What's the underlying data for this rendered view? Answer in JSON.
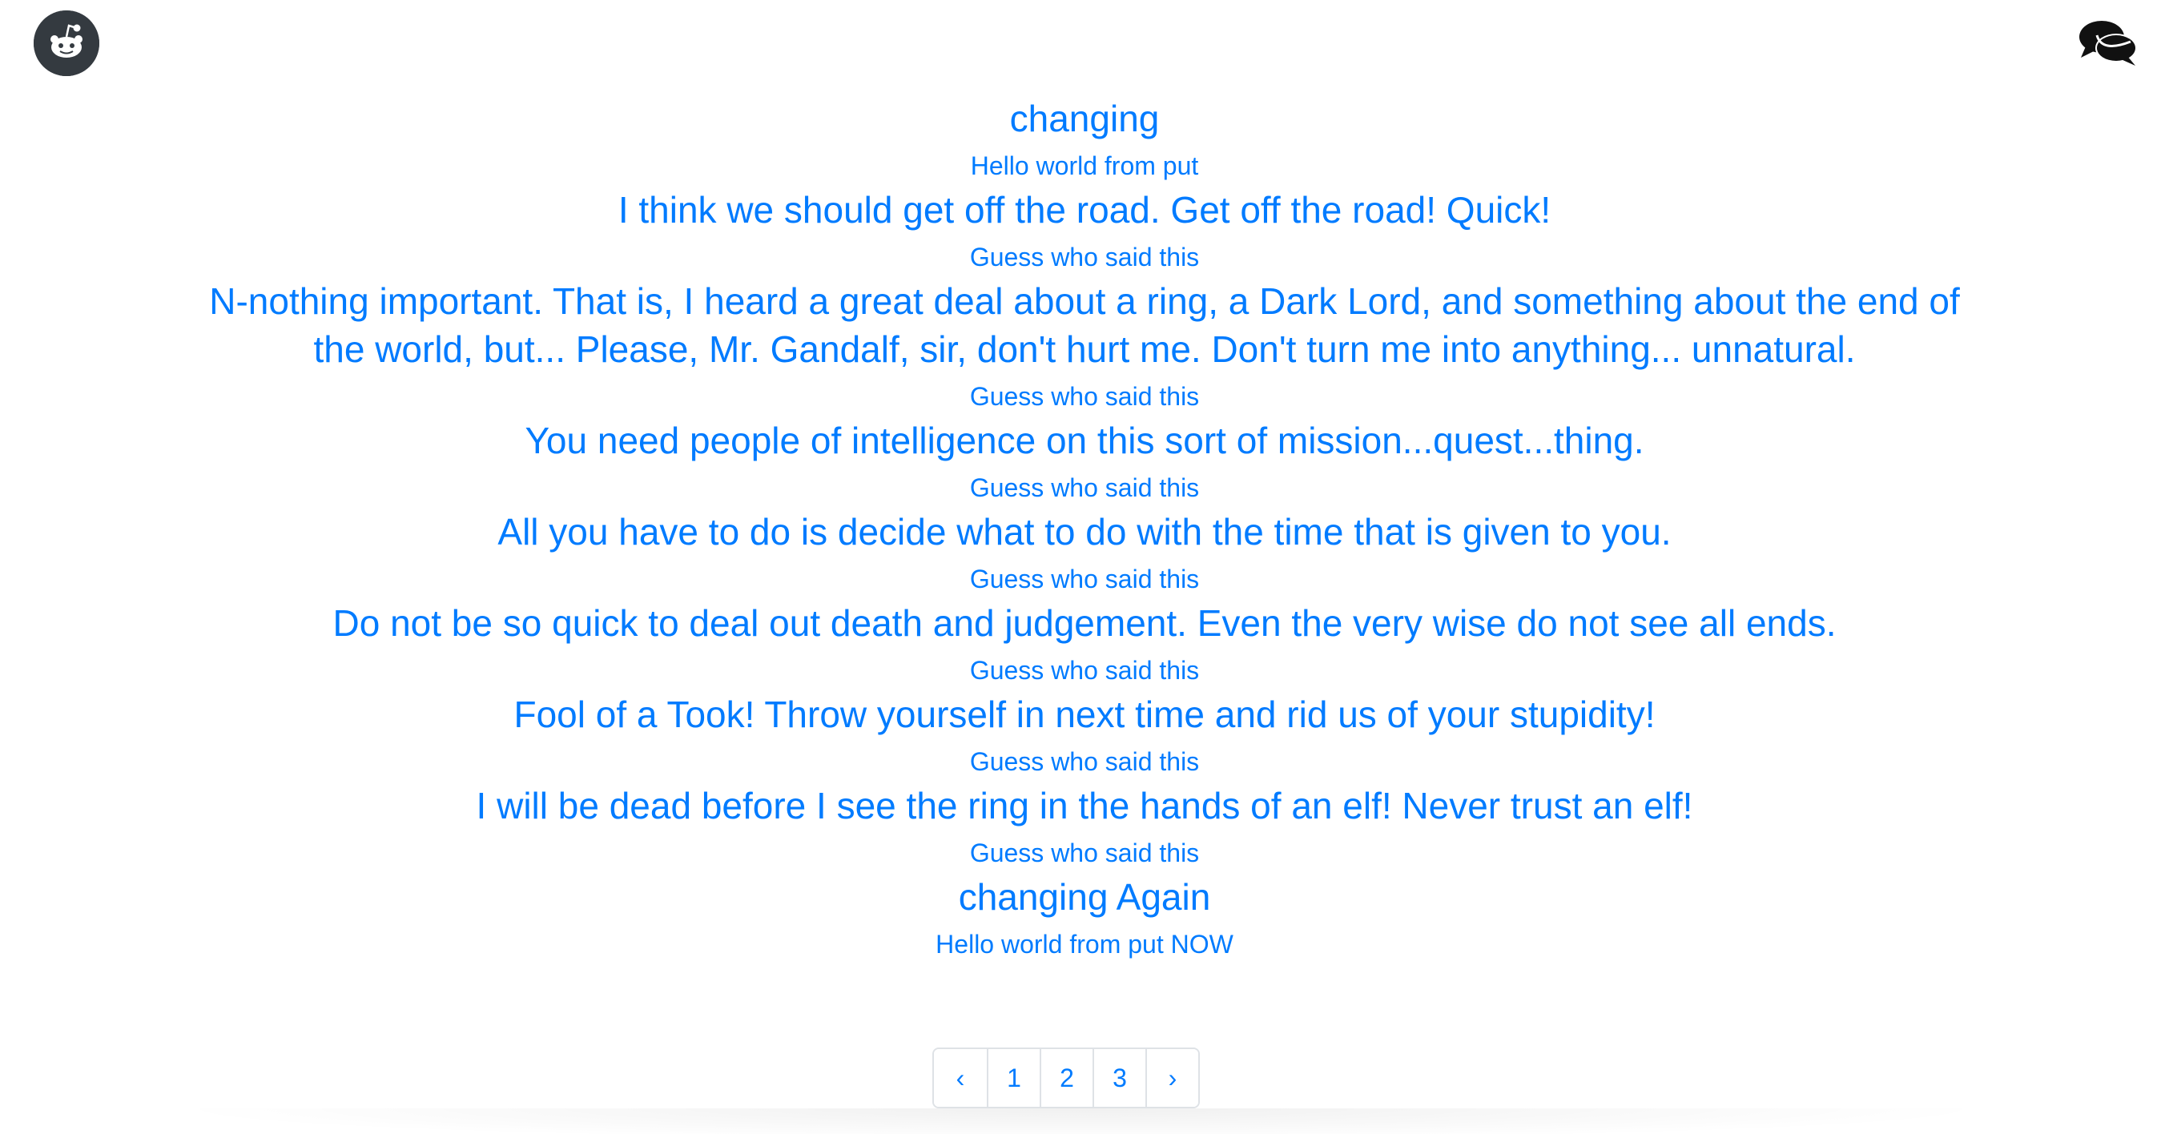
{
  "header": {
    "logo_icon": "reddit-alien-icon",
    "chat_icon": "comments-icon"
  },
  "posts": [
    {
      "title": "changing",
      "subtitle": "Hello world from put"
    },
    {
      "title": "I think we should get off the road. Get off the road! Quick!",
      "subtitle": "Guess who said this"
    },
    {
      "title": "N-nothing important. That is, I heard a great deal about a ring, a Dark Lord, and something about the end of the world, but... Please, Mr. Gandalf, sir, don't hurt me. Don't turn me into anything... unnatural.",
      "subtitle": "Guess who said this"
    },
    {
      "title": "You need people of intelligence on this sort of mission...quest...thing.",
      "subtitle": "Guess who said this"
    },
    {
      "title": "All you have to do is decide what to do with the time that is given to you.",
      "subtitle": "Guess who said this"
    },
    {
      "title": "Do not be so quick to deal out death and judgement. Even the very wise do not see all ends.",
      "subtitle": "Guess who said this"
    },
    {
      "title": "Fool of a Took! Throw yourself in next time and rid us of your stupidity!",
      "subtitle": "Guess who said this"
    },
    {
      "title": "I will be dead before I see the ring in the hands of an elf! Never trust an elf!",
      "subtitle": "Guess who said this"
    },
    {
      "title": "changing Again",
      "subtitle": "Hello world from put NOW"
    }
  ],
  "pagination": {
    "prev": "‹",
    "pages": [
      "1",
      "2",
      "3"
    ],
    "next": "›"
  },
  "colors": {
    "link": "#007bff",
    "icon_dark": "#343a40"
  }
}
